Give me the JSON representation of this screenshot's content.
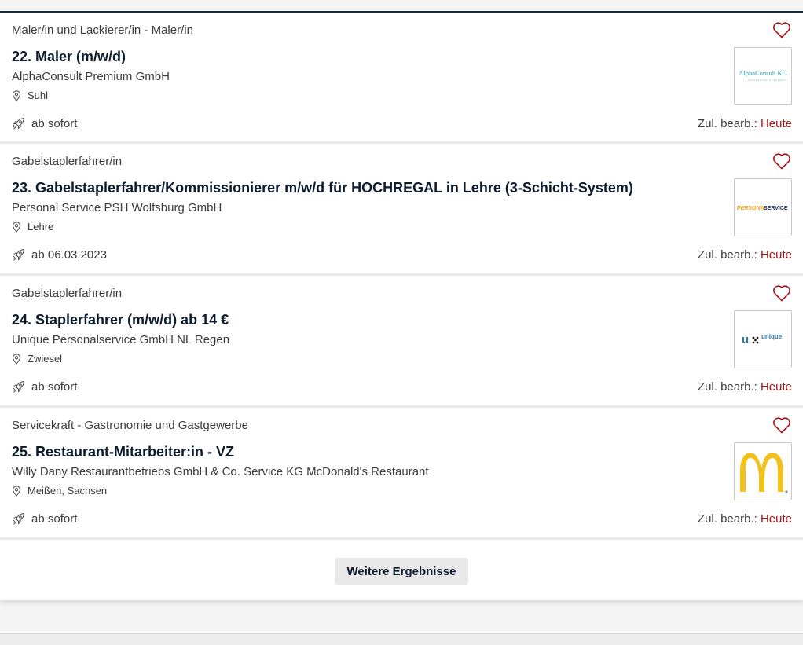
{
  "results": [
    {
      "category": "Maler/in und Lackierer/in - Maler/in",
      "title": "22. Maler (m/w/d)",
      "company": "AlphaConsult Premium GmbH",
      "location": "Suhl",
      "start": "ab sofort",
      "edited_label": "Zul. bearb.:",
      "edited_value": "Heute",
      "logo": "alphaconsult-logo"
    },
    {
      "category": "Gabelstaplerfahrer/in",
      "title": "23. Gabelstaplerfahrer/Kommissionierer m/w/d für HOCHREGAL in Lehre (3-Schicht-System)",
      "company": "Personal Service PSH Wolfsburg GmbH",
      "location": "Lehre",
      "start": "ab 06.03.2023",
      "edited_label": "Zul. bearb.:",
      "edited_value": "Heute",
      "logo": "personal-service-logo"
    },
    {
      "category": "Gabelstaplerfahrer/in",
      "title": "24. Staplerfahrer (m/w/d) ab 14 €",
      "company": "Unique Personalservice GmbH NL Regen",
      "location": "Zwiesel",
      "start": "ab sofort",
      "edited_label": "Zul. bearb.:",
      "edited_value": "Heute",
      "logo": "unique-logo"
    },
    {
      "category": "Servicekraft - Gastronomie und Gastgewerbe",
      "title": "25. Restaurant-Mitarbeiter:in - VZ",
      "company": "Willy Dany Restaurantbetriebs GmbH & Co. Service KG McDonald's Restaurant",
      "location": "Meißen, Sachsen",
      "start": "ab sofort",
      "edited_label": "Zul. bearb.:",
      "edited_value": "Heute",
      "logo": "mcdonalds-logo"
    }
  ],
  "logos": {
    "alphaconsult": "AlphaConsult KG",
    "personal_service_left": "PERSONAL",
    "personal_service_right": "SERVICE",
    "unique_mark": "u",
    "unique_word": "unique"
  },
  "more_button_label": "Weitere Ergebnisse",
  "colors": {
    "title": "#0d1b2e",
    "edited_value": "#a3161b",
    "heart": "#a3161b",
    "mcdonalds_yellow": "#f2c21b",
    "personal_service_orange": "#f0a21a",
    "personal_service_navy": "#1e2a5a",
    "unique_blue": "#2f77a8"
  }
}
